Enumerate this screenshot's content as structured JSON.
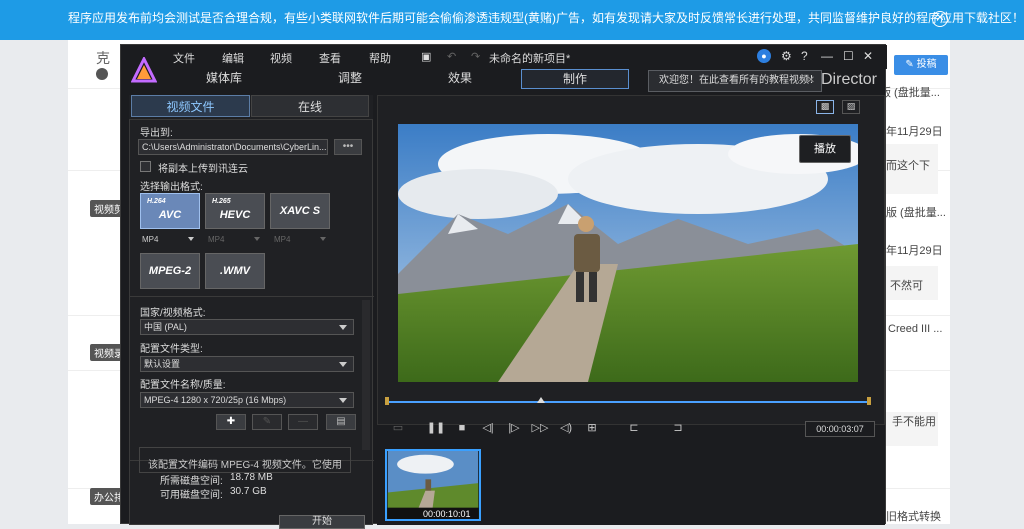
{
  "banner": {
    "text": "程序应用发布前均会测试是否合理合规，有些小类联网软件后期可能会偷偷渗透违规型(黄赌)广告，如有发现请大家及时反馈常长进行处理，共同监督维护良好的程序应用下载社区！",
    "close": "✕"
  },
  "site": {
    "brand": "克",
    "post_button": "投稿",
    "tags": [
      "视频剪",
      "视频录",
      "办公排"
    ],
    "right_texts": [
      "版 (盘批量...",
      "年11月29日",
      "而这个下",
      "版 (盘批量...",
      "年11月29日",
      "不然可",
      "Creed III ...",
      "手不能用",
      "旧格式转换"
    ]
  },
  "app": {
    "menu": [
      "文件",
      "编辑",
      "视频",
      "查看",
      "帮助"
    ],
    "project_title": "未命名的新项目*",
    "tabs": [
      "媒体库",
      "调整",
      "效果",
      "制作"
    ],
    "active_tab": "制作",
    "tip": "欢迎您！在此查看所有的教程视频！",
    "tip_close": "✕",
    "brand_suffix": "Director",
    "panel_tabs": [
      "视频文件",
      "在线"
    ],
    "export_label": "导出到:",
    "export_path": "C:\\Users\\Administrator\\Documents\\CyberLin...",
    "browse": "•••",
    "upload_label": "将副本上传到讯连云",
    "format_label": "选择输出格式:",
    "formats": [
      {
        "sup": "H.264",
        "name": "AVC",
        "selected": true
      },
      {
        "sup": "H.265",
        "name": "HEVC",
        "selected": false
      },
      {
        "sup": "",
        "name": "XAVC S",
        "selected": false
      },
      {
        "sup": "",
        "name": "MPEG-2",
        "selected": false
      },
      {
        "sup": "",
        "name": ".WMV",
        "selected": false
      }
    ],
    "container_opts": [
      "MP4",
      "MP4",
      "MP4"
    ],
    "country_label": "国家/视频格式:",
    "country_value": "中国 (PAL)",
    "profile_type_label": "配置文件类型:",
    "profile_type_value": "默认设置",
    "profile_name_label": "配置文件名称/质量:",
    "profile_name_value": "MPEG-4 1280 x 720/25p (16 Mbps)",
    "desc": "该配置文件编码 MPEG-4 视频文件。它使用",
    "disk_needed_label": "所需磁盘空间:",
    "disk_needed": "18.78 MB",
    "disk_free_label": "可用磁盘空间:",
    "disk_free": "30.7 GB",
    "start": "开始",
    "play": "播放",
    "timecode": "00:00:03:07",
    "thumb_time": "00:00:10:01"
  }
}
